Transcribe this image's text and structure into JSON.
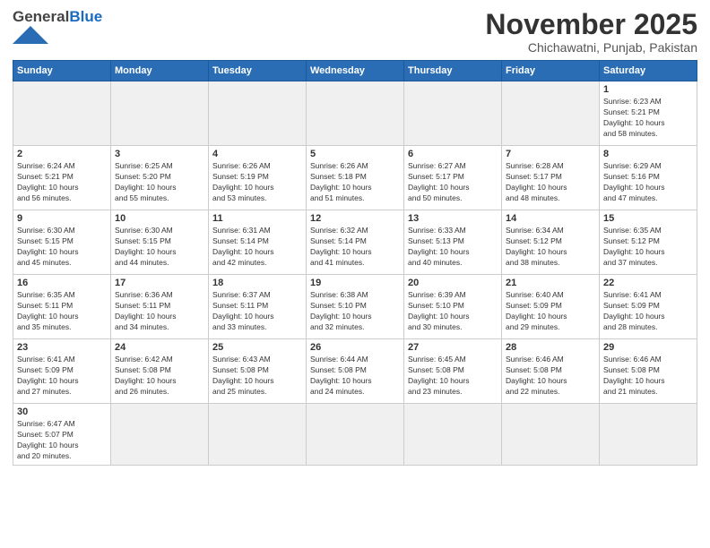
{
  "logo": {
    "text_general": "General",
    "text_blue": "Blue"
  },
  "title": "November 2025",
  "subtitle": "Chichawatni, Punjab, Pakistan",
  "days_of_week": [
    "Sunday",
    "Monday",
    "Tuesday",
    "Wednesday",
    "Thursday",
    "Friday",
    "Saturday"
  ],
  "weeks": [
    [
      {
        "day": "",
        "info": ""
      },
      {
        "day": "",
        "info": ""
      },
      {
        "day": "",
        "info": ""
      },
      {
        "day": "",
        "info": ""
      },
      {
        "day": "",
        "info": ""
      },
      {
        "day": "",
        "info": ""
      },
      {
        "day": "1",
        "info": "Sunrise: 6:23 AM\nSunset: 5:21 PM\nDaylight: 10 hours\nand 58 minutes."
      }
    ],
    [
      {
        "day": "2",
        "info": "Sunrise: 6:24 AM\nSunset: 5:21 PM\nDaylight: 10 hours\nand 56 minutes."
      },
      {
        "day": "3",
        "info": "Sunrise: 6:25 AM\nSunset: 5:20 PM\nDaylight: 10 hours\nand 55 minutes."
      },
      {
        "day": "4",
        "info": "Sunrise: 6:26 AM\nSunset: 5:19 PM\nDaylight: 10 hours\nand 53 minutes."
      },
      {
        "day": "5",
        "info": "Sunrise: 6:26 AM\nSunset: 5:18 PM\nDaylight: 10 hours\nand 51 minutes."
      },
      {
        "day": "6",
        "info": "Sunrise: 6:27 AM\nSunset: 5:17 PM\nDaylight: 10 hours\nand 50 minutes."
      },
      {
        "day": "7",
        "info": "Sunrise: 6:28 AM\nSunset: 5:17 PM\nDaylight: 10 hours\nand 48 minutes."
      },
      {
        "day": "8",
        "info": "Sunrise: 6:29 AM\nSunset: 5:16 PM\nDaylight: 10 hours\nand 47 minutes."
      }
    ],
    [
      {
        "day": "9",
        "info": "Sunrise: 6:30 AM\nSunset: 5:15 PM\nDaylight: 10 hours\nand 45 minutes."
      },
      {
        "day": "10",
        "info": "Sunrise: 6:30 AM\nSunset: 5:15 PM\nDaylight: 10 hours\nand 44 minutes."
      },
      {
        "day": "11",
        "info": "Sunrise: 6:31 AM\nSunset: 5:14 PM\nDaylight: 10 hours\nand 42 minutes."
      },
      {
        "day": "12",
        "info": "Sunrise: 6:32 AM\nSunset: 5:14 PM\nDaylight: 10 hours\nand 41 minutes."
      },
      {
        "day": "13",
        "info": "Sunrise: 6:33 AM\nSunset: 5:13 PM\nDaylight: 10 hours\nand 40 minutes."
      },
      {
        "day": "14",
        "info": "Sunrise: 6:34 AM\nSunset: 5:12 PM\nDaylight: 10 hours\nand 38 minutes."
      },
      {
        "day": "15",
        "info": "Sunrise: 6:35 AM\nSunset: 5:12 PM\nDaylight: 10 hours\nand 37 minutes."
      }
    ],
    [
      {
        "day": "16",
        "info": "Sunrise: 6:35 AM\nSunset: 5:11 PM\nDaylight: 10 hours\nand 35 minutes."
      },
      {
        "day": "17",
        "info": "Sunrise: 6:36 AM\nSunset: 5:11 PM\nDaylight: 10 hours\nand 34 minutes."
      },
      {
        "day": "18",
        "info": "Sunrise: 6:37 AM\nSunset: 5:11 PM\nDaylight: 10 hours\nand 33 minutes."
      },
      {
        "day": "19",
        "info": "Sunrise: 6:38 AM\nSunset: 5:10 PM\nDaylight: 10 hours\nand 32 minutes."
      },
      {
        "day": "20",
        "info": "Sunrise: 6:39 AM\nSunset: 5:10 PM\nDaylight: 10 hours\nand 30 minutes."
      },
      {
        "day": "21",
        "info": "Sunrise: 6:40 AM\nSunset: 5:09 PM\nDaylight: 10 hours\nand 29 minutes."
      },
      {
        "day": "22",
        "info": "Sunrise: 6:41 AM\nSunset: 5:09 PM\nDaylight: 10 hours\nand 28 minutes."
      }
    ],
    [
      {
        "day": "23",
        "info": "Sunrise: 6:41 AM\nSunset: 5:09 PM\nDaylight: 10 hours\nand 27 minutes."
      },
      {
        "day": "24",
        "info": "Sunrise: 6:42 AM\nSunset: 5:08 PM\nDaylight: 10 hours\nand 26 minutes."
      },
      {
        "day": "25",
        "info": "Sunrise: 6:43 AM\nSunset: 5:08 PM\nDaylight: 10 hours\nand 25 minutes."
      },
      {
        "day": "26",
        "info": "Sunrise: 6:44 AM\nSunset: 5:08 PM\nDaylight: 10 hours\nand 24 minutes."
      },
      {
        "day": "27",
        "info": "Sunrise: 6:45 AM\nSunset: 5:08 PM\nDaylight: 10 hours\nand 23 minutes."
      },
      {
        "day": "28",
        "info": "Sunrise: 6:46 AM\nSunset: 5:08 PM\nDaylight: 10 hours\nand 22 minutes."
      },
      {
        "day": "29",
        "info": "Sunrise: 6:46 AM\nSunset: 5:08 PM\nDaylight: 10 hours\nand 21 minutes."
      }
    ],
    [
      {
        "day": "30",
        "info": "Sunrise: 6:47 AM\nSunset: 5:07 PM\nDaylight: 10 hours\nand 20 minutes."
      },
      {
        "day": "",
        "info": ""
      },
      {
        "day": "",
        "info": ""
      },
      {
        "day": "",
        "info": ""
      },
      {
        "day": "",
        "info": ""
      },
      {
        "day": "",
        "info": ""
      },
      {
        "day": "",
        "info": ""
      }
    ]
  ]
}
